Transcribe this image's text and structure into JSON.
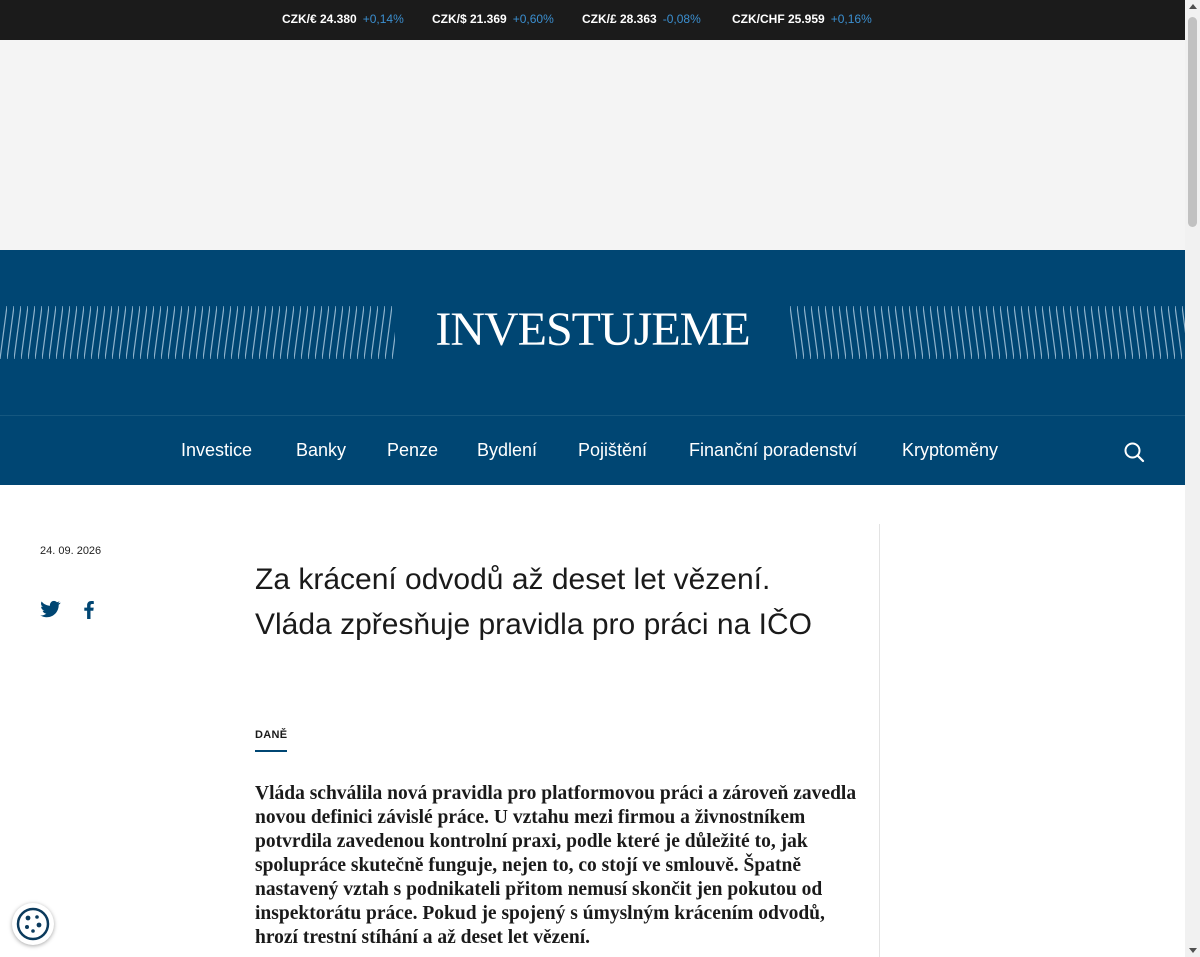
{
  "ticker": [
    {
      "pair": "CZK/€ 24.380",
      "change": "+0,14%"
    },
    {
      "pair": "CZK/$ 21.369",
      "change": "+0,60%"
    },
    {
      "pair": "CZK/£ 28.363",
      "change": "-0,08%"
    },
    {
      "pair": "CZK/CHF 25.959",
      "change": "+0,16%"
    }
  ],
  "brand": {
    "logo": "INVESTUJEME",
    "color": "#004673"
  },
  "nav": {
    "items": [
      "Investice",
      "Banky",
      "Penze",
      "Bydlení",
      "Pojištění",
      "Finanční poradenství",
      "Kryptoměny"
    ],
    "search_icon": "search-icon"
  },
  "article": {
    "date": "24. 09. 2026",
    "share": {
      "twitter_icon": "twitter-icon",
      "facebook_icon": "facebook-icon"
    },
    "title": "Za krácení odvodů až deset let vězení. Vláda zpřesňuje pravidla pro práci na IČO",
    "category": "DANĚ",
    "perex": "Vláda schválila nová pravidla pro platformovou práci a zároveň zavedla novou definici závislé práce. U vztahu mezi firmou a živnostníkem potvrdila zavedenou kontrolní praxi, podle které je důležité to, jak spolupráce skutečně funguje, nejen to, co stojí ve smlouvě. Špatně nastavený vztah s podnikateli přitom nemusí skončit jen pokutou od inspektorátu práce. Pokud je spojený s úmyslným krácením odvodů, hrozí trestní stíhání a až deset let vězení."
  },
  "cookie": {
    "icon": "cookie-icon"
  }
}
